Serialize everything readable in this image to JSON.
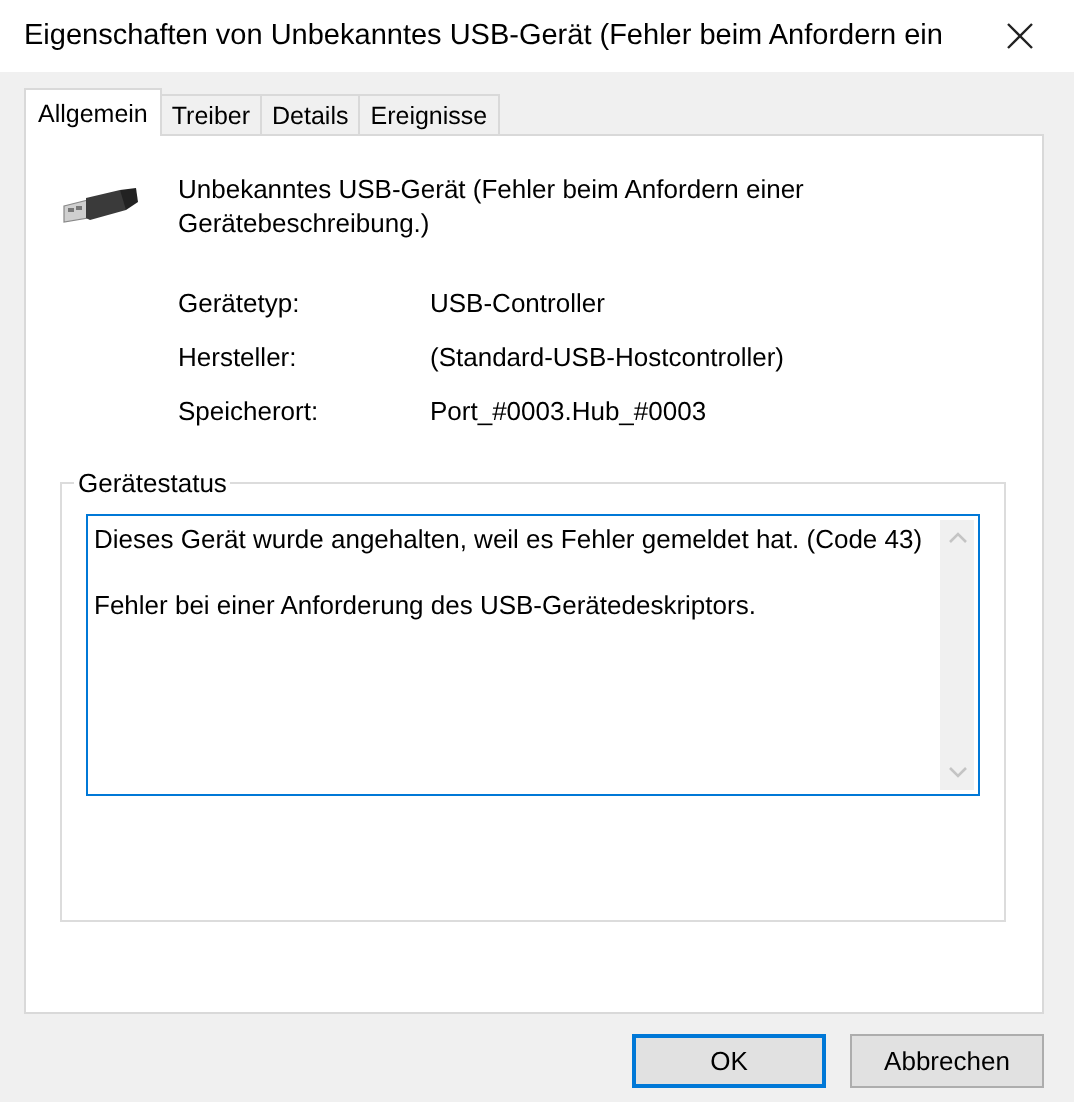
{
  "window": {
    "title": "Eigenschaften von Unbekanntes USB-Gerät (Fehler beim Anfordern ein"
  },
  "tabs": [
    {
      "label": "Allgemein",
      "selected": true
    },
    {
      "label": "Treiber",
      "selected": false
    },
    {
      "label": "Details",
      "selected": false
    },
    {
      "label": "Ereignisse",
      "selected": false
    }
  ],
  "device": {
    "name": "Unbekanntes USB-Gerät (Fehler beim Anfordern einer Gerätebeschreibung.)"
  },
  "properties": [
    {
      "label": "Gerätetyp:",
      "value": "USB-Controller"
    },
    {
      "label": "Hersteller:",
      "value": "(Standard-USB-Hostcontroller)"
    },
    {
      "label": "Speicherort:",
      "value": "Port_#0003.Hub_#0003"
    }
  ],
  "device_status": {
    "title": "Gerätestatus",
    "lines": [
      "Dieses Gerät wurde angehalten, weil es Fehler gemeldet hat. (Code 43)",
      "Fehler bei einer Anforderung des USB-Gerätedeskriptors."
    ]
  },
  "buttons": [
    {
      "label": "OK",
      "default": true
    },
    {
      "label": "Abbrechen",
      "default": false
    }
  ]
}
